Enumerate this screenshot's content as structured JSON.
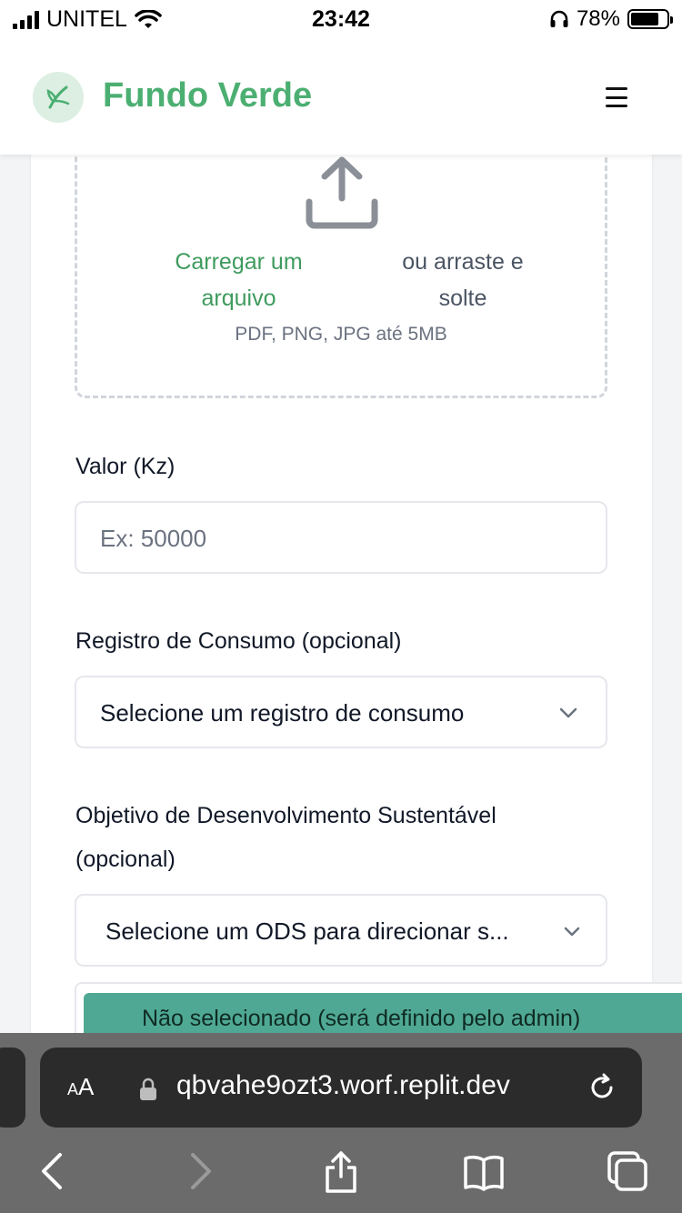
{
  "status_bar": {
    "carrier": "UNITEL",
    "time": "23:42",
    "battery": "78%"
  },
  "header": {
    "brand": "Fundo Verde",
    "logo_icon": "leaf-icon",
    "menu_icon": "hamburger-menu-icon"
  },
  "upload": {
    "icon": "upload-icon",
    "link_text": "Carregar um arquivo",
    "rest_text": "ou arraste e solte",
    "hint": "PDF, PNG, JPG até 5MB"
  },
  "fields": {
    "valor": {
      "label": "Valor (Kz)",
      "placeholder": "Ex: 50000"
    },
    "consumo": {
      "label": "Registro de Consumo (opcional)",
      "value": "Selecione um registro de consumo"
    },
    "ods": {
      "label_line1": "Objetivo de Desenvolvimento Sustentável",
      "label_line2": "(opcional)",
      "value": "Selecione um ODS para direcionar s..."
    }
  },
  "dropdown": {
    "selected_option": "Não selecionado (será definido pelo admin)"
  },
  "browser": {
    "text_size_label": "AA",
    "url": "qbvahe9ozt3.worf.replit.dev"
  },
  "colors": {
    "brand": "#4caf72",
    "link": "#3f9b5e",
    "selected_option_bg": "#4fa894"
  }
}
